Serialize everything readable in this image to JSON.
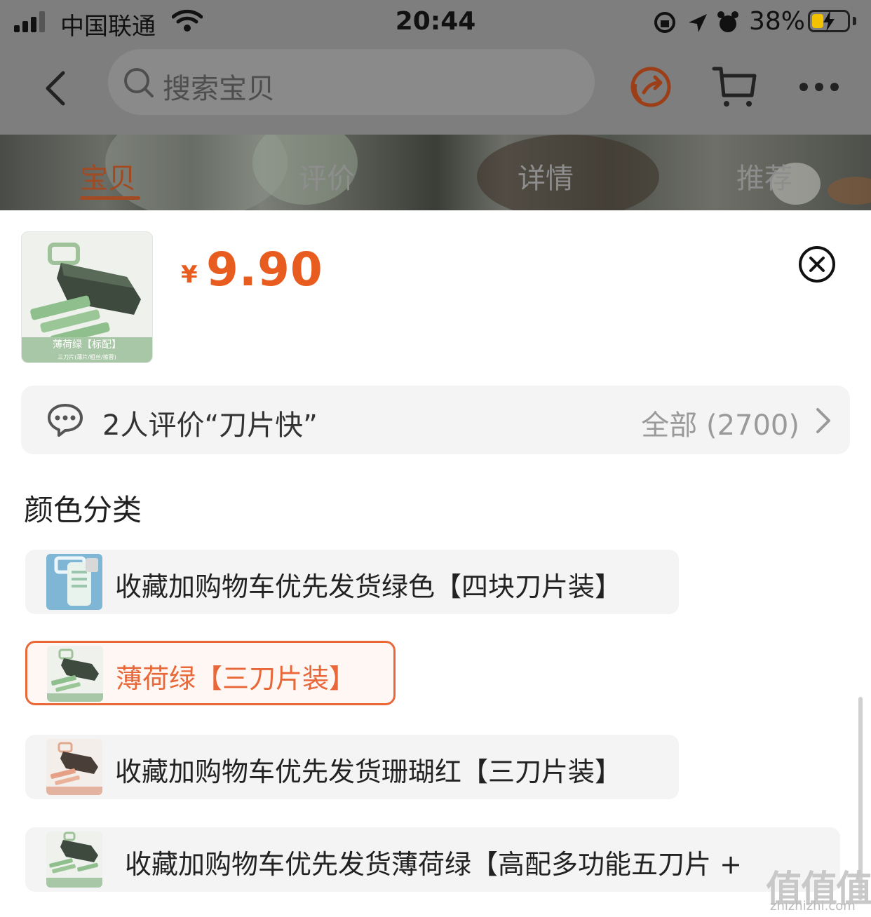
{
  "status_bar": {
    "carrier": "中国联通",
    "time": "20:44",
    "battery_pct": "38%"
  },
  "nav": {
    "search_placeholder": "搜索宝贝"
  },
  "tabs": [
    {
      "label": "宝贝",
      "active": true
    },
    {
      "label": "评价",
      "active": false
    },
    {
      "label": "详情",
      "active": false
    },
    {
      "label": "推荐",
      "active": false
    }
  ],
  "product": {
    "currency": "¥",
    "price": "9.90",
    "thumb_caption": "薄荷绿【标配】",
    "thumb_subcaption": "三刀片(薄片/粗丝/擦蓉)"
  },
  "review": {
    "summary": "2人评价“刀片快”",
    "all_label": "全部 (2700)"
  },
  "section": {
    "title": "颜色分类"
  },
  "options": [
    {
      "label": "收藏加购物车优先发货绿色【四块刀片装】",
      "selected": false
    },
    {
      "label": "薄荷绿【三刀片装】",
      "selected": true
    },
    {
      "label": "收藏加购物车优先发货珊瑚红【三刀片装】",
      "selected": false
    },
    {
      "label": "收藏加购物车优先发货薄荷绿【高配多功能五刀片 +",
      "selected": false
    }
  ],
  "watermark": {
    "text": "值值值",
    "domain": "zhizhizhi.com"
  },
  "colors": {
    "accent": "#e85d1f",
    "selected_border": "#e8683a",
    "tab_active": "#a24a22",
    "option_bg": "#f4f4f4"
  },
  "icons": [
    "back-arrow-icon",
    "search-icon",
    "share-icon",
    "cart-icon",
    "more-icon",
    "close-icon",
    "chat-bubble-icon",
    "chevron-right-icon",
    "wifi-icon",
    "alarm-icon",
    "location-icon",
    "lock-rotation-icon"
  ]
}
